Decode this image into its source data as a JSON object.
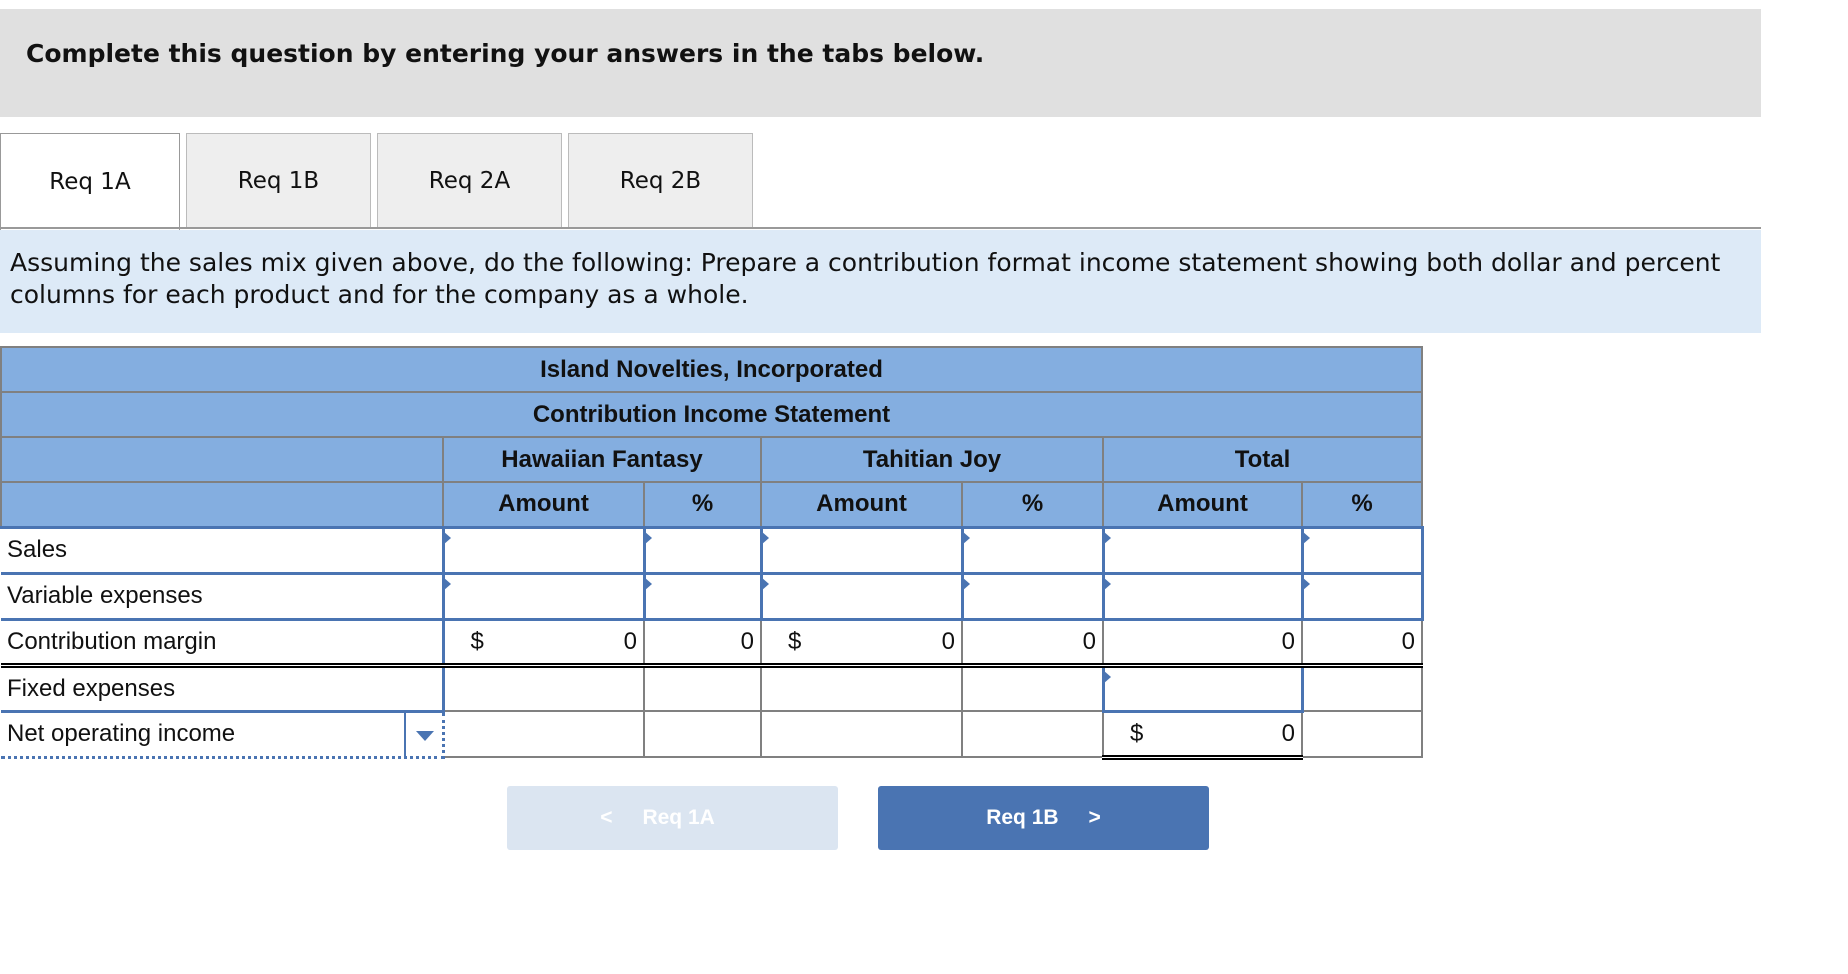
{
  "header": {
    "instruction": "Complete this question by entering your answers in the tabs below."
  },
  "tabs": [
    {
      "label": "Req 1A",
      "active": true
    },
    {
      "label": "Req 1B"
    },
    {
      "label": "Req 2A"
    },
    {
      "label": "Req 2B"
    }
  ],
  "prompt": "Assuming the sales mix given above, do the following: Prepare a contribution format income statement showing both dollar and percent columns for each product and for the company as a whole.",
  "statement": {
    "company": "Island Novelties, Incorporated",
    "title": "Contribution Income Statement",
    "products": [
      "Hawaiian Fantasy",
      "Tahitian Joy",
      "Total"
    ],
    "col_amount": "Amount",
    "col_pct": "%",
    "rows": {
      "sales": "Sales",
      "variable": "Variable expenses",
      "cm": "Contribution margin",
      "fixed": "Fixed expenses",
      "noi": "Net operating income"
    },
    "currency": "$",
    "cm_values": [
      "0",
      "0",
      "0",
      "0",
      "0",
      "0"
    ],
    "noi_total": "0"
  },
  "nav": {
    "prev": "Req 1A",
    "next": "Req 1B"
  },
  "colors": {
    "accent": "#4a74b2",
    "header_bg": "#84aee0"
  }
}
